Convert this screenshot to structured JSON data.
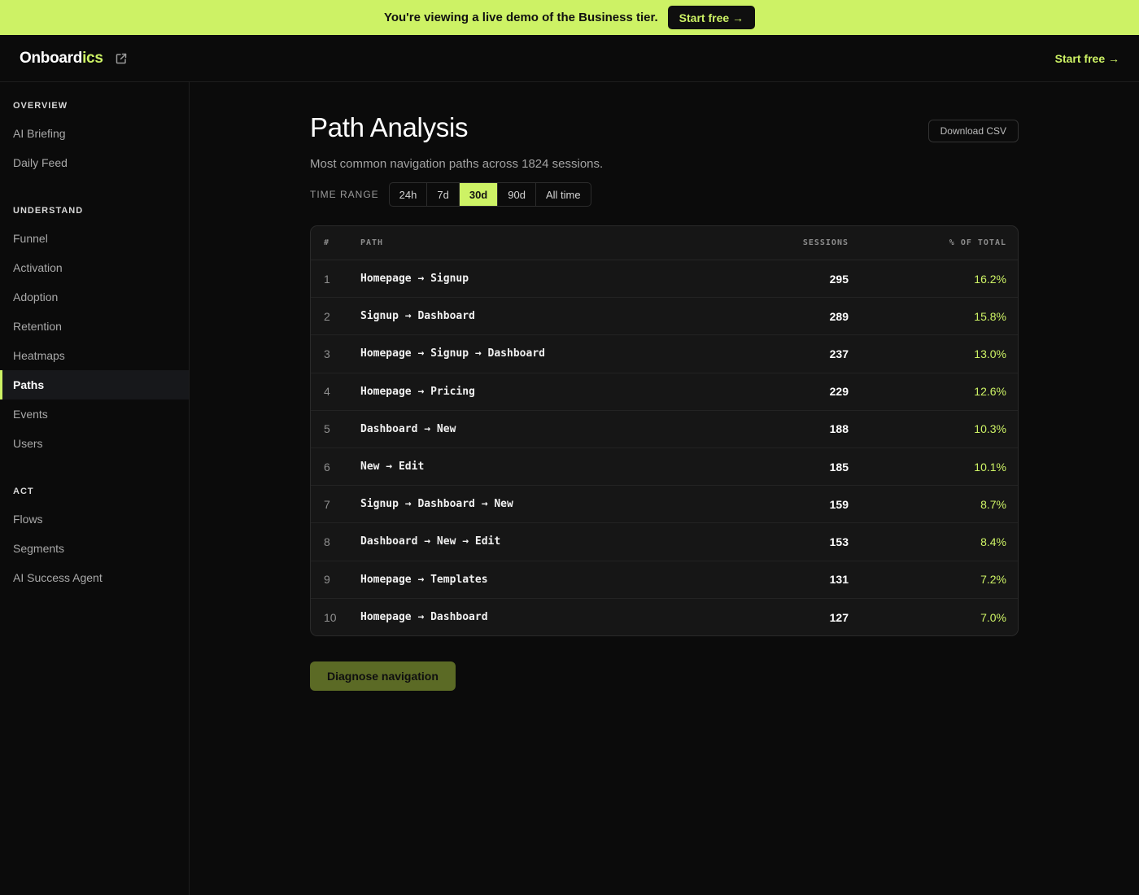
{
  "banner": {
    "text": "You're viewing a live demo of the Business tier.",
    "cta": "Start free →"
  },
  "header": {
    "logo_main": "Onboard",
    "logo_accent": "ics",
    "cta": "Start free →"
  },
  "sidebar": {
    "sections": [
      {
        "title": "OVERVIEW",
        "items": [
          "AI Briefing",
          "Daily Feed"
        ]
      },
      {
        "title": "UNDERSTAND",
        "items": [
          "Funnel",
          "Activation",
          "Adoption",
          "Retention",
          "Heatmaps",
          "Paths",
          "Events",
          "Users"
        ]
      },
      {
        "title": "ACT",
        "items": [
          "Flows",
          "Segments",
          "AI Success Agent"
        ]
      }
    ],
    "active": "Paths"
  },
  "main": {
    "title": "Path Analysis",
    "subtitle": "Most common navigation paths across 1824 sessions.",
    "download_label": "Download CSV",
    "time_range": {
      "label": "TIME RANGE",
      "options": [
        "24h",
        "7d",
        "30d",
        "90d",
        "All time"
      ],
      "selected": "30d"
    },
    "table": {
      "headers": {
        "rank": "#",
        "path": "PATH",
        "sessions": "SESSIONS",
        "pct": "% OF TOTAL"
      },
      "rows": [
        {
          "rank": "1",
          "path": "Homepage → Signup",
          "sessions": "295",
          "pct": "16.2%"
        },
        {
          "rank": "2",
          "path": "Signup → Dashboard",
          "sessions": "289",
          "pct": "15.8%"
        },
        {
          "rank": "3",
          "path": "Homepage → Signup → Dashboard",
          "sessions": "237",
          "pct": "13.0%"
        },
        {
          "rank": "4",
          "path": "Homepage → Pricing",
          "sessions": "229",
          "pct": "12.6%"
        },
        {
          "rank": "5",
          "path": "Dashboard → New",
          "sessions": "188",
          "pct": "10.3%"
        },
        {
          "rank": "6",
          "path": "New → Edit",
          "sessions": "185",
          "pct": "10.1%"
        },
        {
          "rank": "7",
          "path": "Signup → Dashboard → New",
          "sessions": "159",
          "pct": "8.7%"
        },
        {
          "rank": "8",
          "path": "Dashboard → New → Edit",
          "sessions": "153",
          "pct": "8.4%"
        },
        {
          "rank": "9",
          "path": "Homepage → Templates",
          "sessions": "131",
          "pct": "7.2%"
        },
        {
          "rank": "10",
          "path": "Homepage → Dashboard",
          "sessions": "127",
          "pct": "7.0%"
        }
      ]
    },
    "diagnose_label": "Diagnose navigation"
  },
  "colors": {
    "accent": "#cdf265",
    "background": "#0b0b0b",
    "card": "#161616",
    "diagnose_button": "#5b6a25"
  }
}
